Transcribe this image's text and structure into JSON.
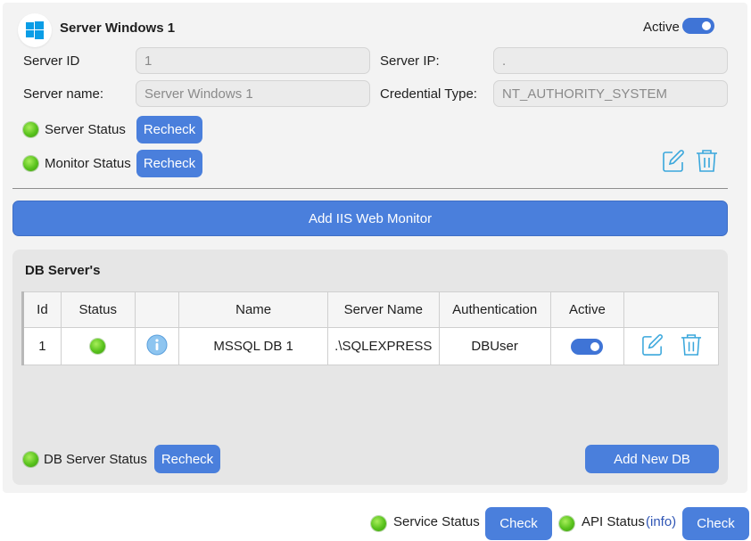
{
  "server": {
    "title": "Server Windows 1",
    "active_label": "Active",
    "active": true,
    "server_id_label": "Server ID",
    "server_id_value": "1",
    "server_ip_label": "Server IP:",
    "server_ip_value": ".",
    "server_name_label": "Server name:",
    "server_name_value": "Server Windows 1",
    "credential_type_label": "Credential Type:",
    "credential_type_value": "NT_AUTHORITY_SYSTEM",
    "server_status_label": "Server Status",
    "monitor_status_label": "Monitor Status",
    "recheck_label": "Recheck",
    "status_color": "#58c21c"
  },
  "add_iis_label": "Add IIS Web Monitor",
  "db_panel": {
    "title": "DB Server's",
    "columns": [
      "Id",
      "Status",
      "",
      "Name",
      "Server Name",
      "Authentication",
      "Active",
      ""
    ],
    "rows": [
      {
        "id": "1",
        "name": "MSSQL DB 1",
        "server_name": ".\\SQLEXPRESS",
        "authentication": "DBUser",
        "active": true
      }
    ],
    "status_label": "DB Server Status",
    "recheck_label": "Recheck",
    "add_new_label": "Add New DB"
  },
  "footer": {
    "service_status_label": "Service Status",
    "check_label": "Check",
    "api_status_label": "API Status",
    "info_link": "(info)",
    "check2_label": "Check"
  },
  "colors": {
    "accent": "#4a7fdc",
    "icon_cyan": "#3aa7dc",
    "windows_blue": "#0a9de6"
  },
  "icons": [
    "windows-logo-icon",
    "edit-icon",
    "delete-icon",
    "info-icon"
  ]
}
